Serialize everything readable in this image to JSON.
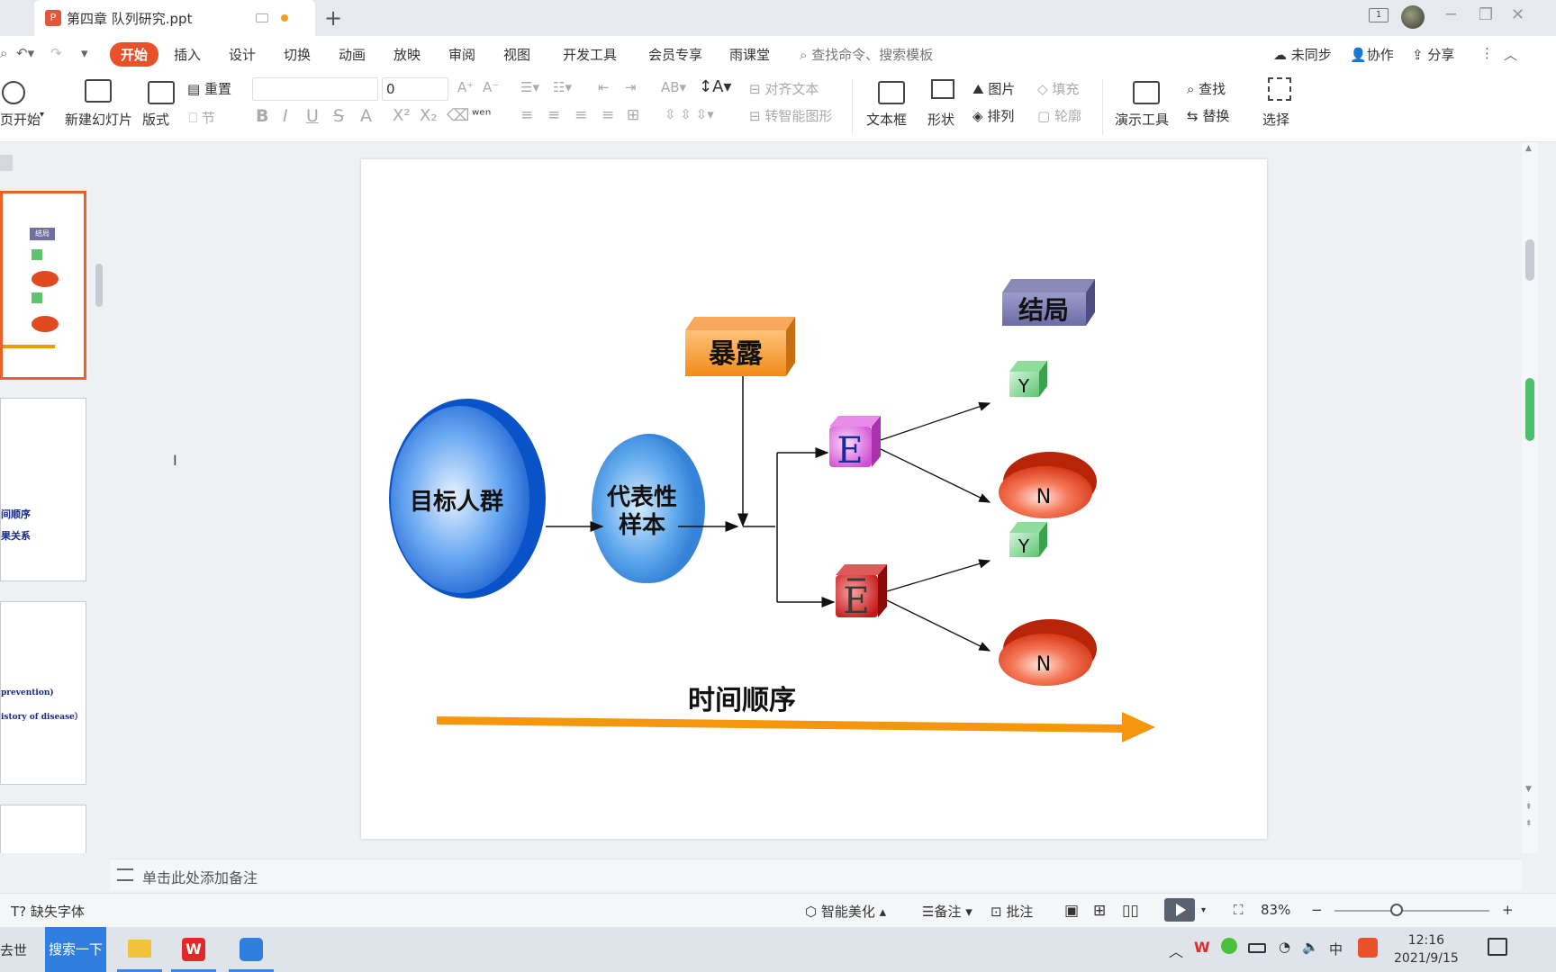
{
  "window": {
    "doc_title": "第四章 队列研究.ppt"
  },
  "menu": {
    "items": [
      "开始",
      "插入",
      "设计",
      "切换",
      "动画",
      "放映",
      "审阅",
      "视图",
      "开发工具",
      "会员专享",
      "雨课堂"
    ],
    "active": "开始",
    "search_placeholder": "查找命令、搜索模板",
    "unsynced": "未同步",
    "collaborate": "协作",
    "share": "分享"
  },
  "ribbon": {
    "from_page": "页开始",
    "new_slide": "新建幻灯片",
    "layout": "版式",
    "reset": "重置",
    "section": "节",
    "font_size": "0",
    "align_text": "对齐文本",
    "smart_shape": "转智能图形",
    "text_box": "文本框",
    "shape": "形状",
    "picture": "图片",
    "fill": "填充",
    "arrange": "排列",
    "outline": "轮廓",
    "present_tools": "演示工具",
    "find": "查找",
    "replace": "替换",
    "select": "选择"
  },
  "thumbnails": {
    "slide_mini_outcome": "结局",
    "slide2_line1": "间顺序",
    "slide2_line2": "果关系",
    "slide3_line1": "prevention)",
    "slide3_line2": "istory of disease）"
  },
  "slide": {
    "target_population": "目标人群",
    "representative_sample": [
      "代表性",
      "样本"
    ],
    "exposure": "暴露",
    "outcome": "结局",
    "exposed": "E",
    "unexposed": "E",
    "yes": "Y",
    "no": "N",
    "time_order": "时间顺序"
  },
  "notes": {
    "placeholder": "单击此处添加备注"
  },
  "status": {
    "missing_font": "缺失字体",
    "smart_beautify": "智能美化",
    "notes": "备注",
    "comment": "批注",
    "zoom": "83%"
  },
  "taskbar": {
    "left_text": "去世",
    "search": "搜索一下",
    "ime": "中",
    "time": "12:16",
    "date": "2021/9/15"
  },
  "colors": {
    "accent": "#e8512a",
    "arrow_orange": "#f5960f"
  }
}
